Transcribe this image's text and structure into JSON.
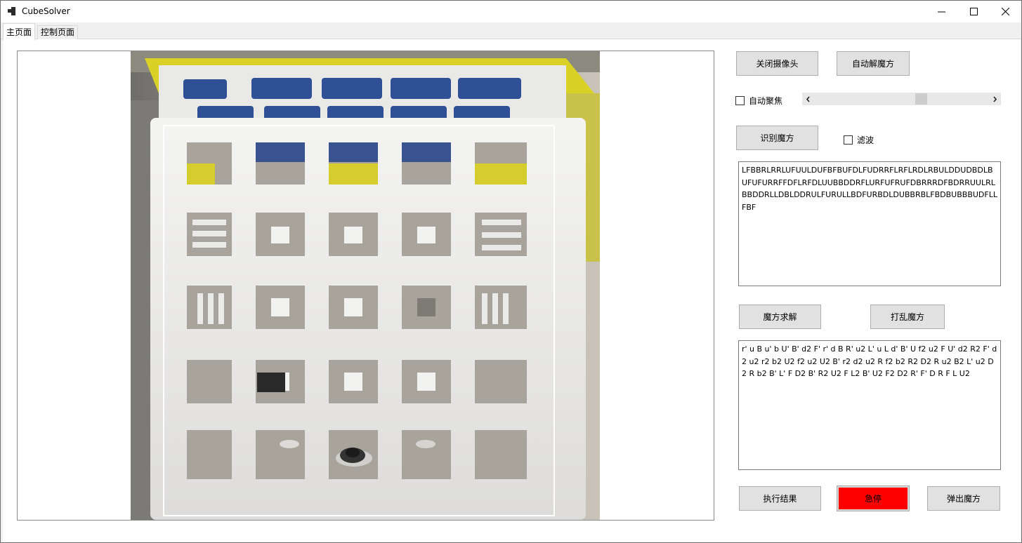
{
  "window": {
    "title": "CubeSolver"
  },
  "tabs": [
    {
      "label": "主页面",
      "active": true
    },
    {
      "label": "控制页面",
      "active": false
    }
  ],
  "camera": {
    "guide_frame_color": "#ffffff"
  },
  "controls": {
    "close_camera_label": "关闭摄像头",
    "auto_solve_label": "自动解魔方",
    "autofocus_label": "自动聚焦",
    "autofocus_checked": false,
    "focus_slider_value": 0.62,
    "recognize_label": "识别魔方",
    "filter_label": "滤波",
    "filter_checked": false,
    "solve_label": "魔方求解",
    "scramble_label": "打乱魔方",
    "execute_label": "执行结果",
    "estop_label": "急停",
    "estop_color": "#ff0000",
    "eject_label": "弹出魔方"
  },
  "cube_state_text": "LFBBRLRRLUFUULDUFBFBUFDLFUDRRFLRFLRDLRBULDDUDBDLBUFUFURRFFDFLRFDLUUBBDDRFLURFUFRUFDBRRRDFBDRRUULRLBBDDRLLDBLDDRULFURULLBDFURBDLDUBBRBLFBDBUBBBUDFLLFBF",
  "solution_text": "r' u B u' b U' B' d2 F' r' d B R' u2 L' u L d' B' U f2 u2 F U' d2 R2 F' d2 u2 r2 b2 U2 f2 u2 U2 B' r2 d2 u2 R f2 b2 R2 D2 R u2 B2 L' u2 D2 R b2 B' L' F D2 B' R2 U2 F L2 B' U2 F2 D2 R' F' D R F L U2"
}
